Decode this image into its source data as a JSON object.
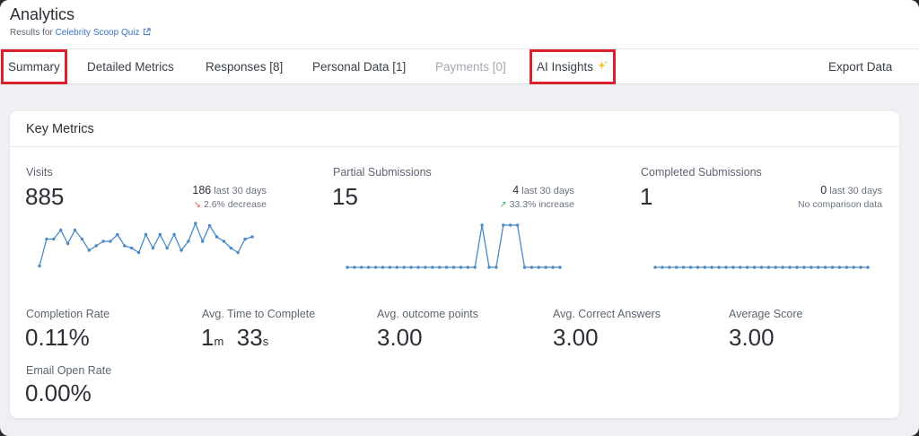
{
  "header": {
    "title": "Analytics",
    "subtitle_prefix": "Results for",
    "quiz_name": "Celebrity Scoop Quiz"
  },
  "tabs": [
    {
      "label": "Summary",
      "highlighted": true
    },
    {
      "label": "Detailed Metrics"
    },
    {
      "label": "Responses [8]"
    },
    {
      "label": "Personal Data [1]"
    },
    {
      "label": "Payments [0]",
      "disabled": true
    },
    {
      "label": "AI Insights",
      "highlighted": true,
      "icon": "sparkle-icon"
    },
    {
      "label": "Export Data"
    }
  ],
  "colors": {
    "highlight_border": "#d9202c",
    "link": "#3b74c9",
    "sparkline": "#4a8ac6",
    "decrease": "#e0605a",
    "increase": "#3fb37f"
  },
  "key_metrics": {
    "title": "Key Metrics",
    "visits": {
      "label": "Visits",
      "value": "885",
      "count": "186",
      "period": "last 30 days",
      "change": "2.6% decrease",
      "trend": "down",
      "series": [
        3,
        15,
        15,
        19,
        13,
        19,
        15,
        10,
        12,
        14,
        14,
        17,
        12,
        11,
        9,
        17,
        11,
        17,
        11,
        17,
        10,
        14,
        22,
        14,
        21,
        16,
        14,
        11,
        9,
        15,
        16
      ]
    },
    "partial": {
      "label": "Partial Submissions",
      "value": "15",
      "count": "4",
      "period": "last 30 days",
      "change": "33.3% increase",
      "trend": "up",
      "series": [
        0,
        0,
        0,
        0,
        0,
        0,
        0,
        0,
        0,
        0,
        0,
        0,
        0,
        0,
        0,
        0,
        0,
        0,
        0,
        1,
        0,
        0,
        1,
        1,
        1,
        0,
        0,
        0,
        0,
        0,
        0
      ]
    },
    "completed": {
      "label": "Completed Submissions",
      "value": "1",
      "count": "0",
      "period": "last 30 days",
      "change": "No comparison data",
      "series": [
        0,
        0,
        0,
        0,
        0,
        0,
        0,
        0,
        0,
        0,
        0,
        0,
        0,
        0,
        0,
        0,
        0,
        0,
        0,
        0,
        0,
        0,
        0,
        0,
        0,
        0,
        0,
        0,
        0,
        0,
        0
      ]
    },
    "completion_rate": {
      "label": "Completion Rate",
      "value": "0.11%"
    },
    "avg_time": {
      "label": "Avg. Time to Complete",
      "minutes": "1",
      "minutes_unit": "m",
      "seconds": "33",
      "seconds_unit": "s"
    },
    "avg_outcome": {
      "label": "Avg. outcome points",
      "value": "3.00"
    },
    "avg_correct": {
      "label": "Avg. Correct Answers",
      "value": "3.00"
    },
    "avg_score": {
      "label": "Average Score",
      "value": "3.00"
    },
    "email_open": {
      "label": "Email Open Rate",
      "value": "0.00%"
    }
  }
}
